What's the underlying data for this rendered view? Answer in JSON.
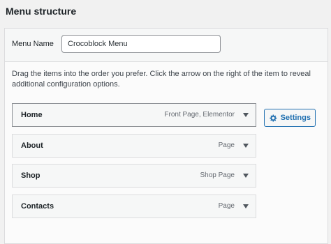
{
  "heading": "Menu structure",
  "menu_name": {
    "label": "Menu Name",
    "value": "Crocoblock Menu"
  },
  "instructions": "Drag the items into the order you prefer. Click the arrow on the right of the item to reveal additional configuration options.",
  "items": [
    {
      "title": "Home",
      "type": "Front Page, Elementor"
    },
    {
      "title": "About",
      "type": "Page"
    },
    {
      "title": "Shop",
      "type": "Shop Page"
    },
    {
      "title": "Contacts",
      "type": "Page"
    }
  ],
  "settings_label": "Settings",
  "colors": {
    "accent": "#2271b1",
    "text": "#1d2327",
    "muted": "#646970",
    "border": "#dcdcde"
  }
}
